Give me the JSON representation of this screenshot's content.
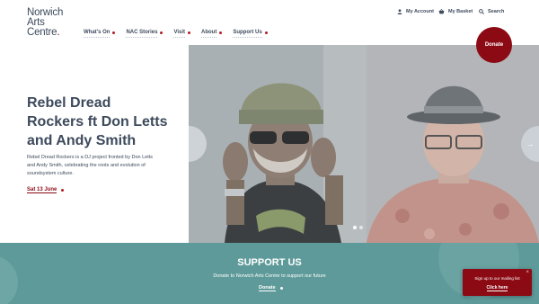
{
  "brand": {
    "logo_lines": [
      "Norwich",
      "Arts",
      "Centre"
    ],
    "logo_dot": "."
  },
  "utility": {
    "account": "My Account",
    "basket": "My Basket",
    "search": "Search"
  },
  "nav": {
    "items": [
      {
        "label": "What's On"
      },
      {
        "label": "NAC Stories"
      },
      {
        "label": "Visit"
      },
      {
        "label": "About"
      },
      {
        "label": "Support Us"
      }
    ]
  },
  "donate_badge": "Donate",
  "hero": {
    "title": "Rebel Dread Rockers ft Don Letts and Andy Smith",
    "description": "Rebel Dread Rockers is a DJ project fronted by Don Letts and Andy Smith, celebrating the roots and evolution of soundsystem culture.",
    "date_link": "Sat 13 June",
    "next_arrow": "→"
  },
  "support": {
    "title": "SUPPORT US",
    "text": "Donate to Norwich Arts Centre to support our future",
    "link": "Donate"
  },
  "popup": {
    "text": "Sign up to our mailing list",
    "link": "Click here",
    "close": "×"
  },
  "colors": {
    "brand_red": "#8b0a14",
    "text_navy": "#3d4a5c",
    "teal": "#5e9a99"
  }
}
